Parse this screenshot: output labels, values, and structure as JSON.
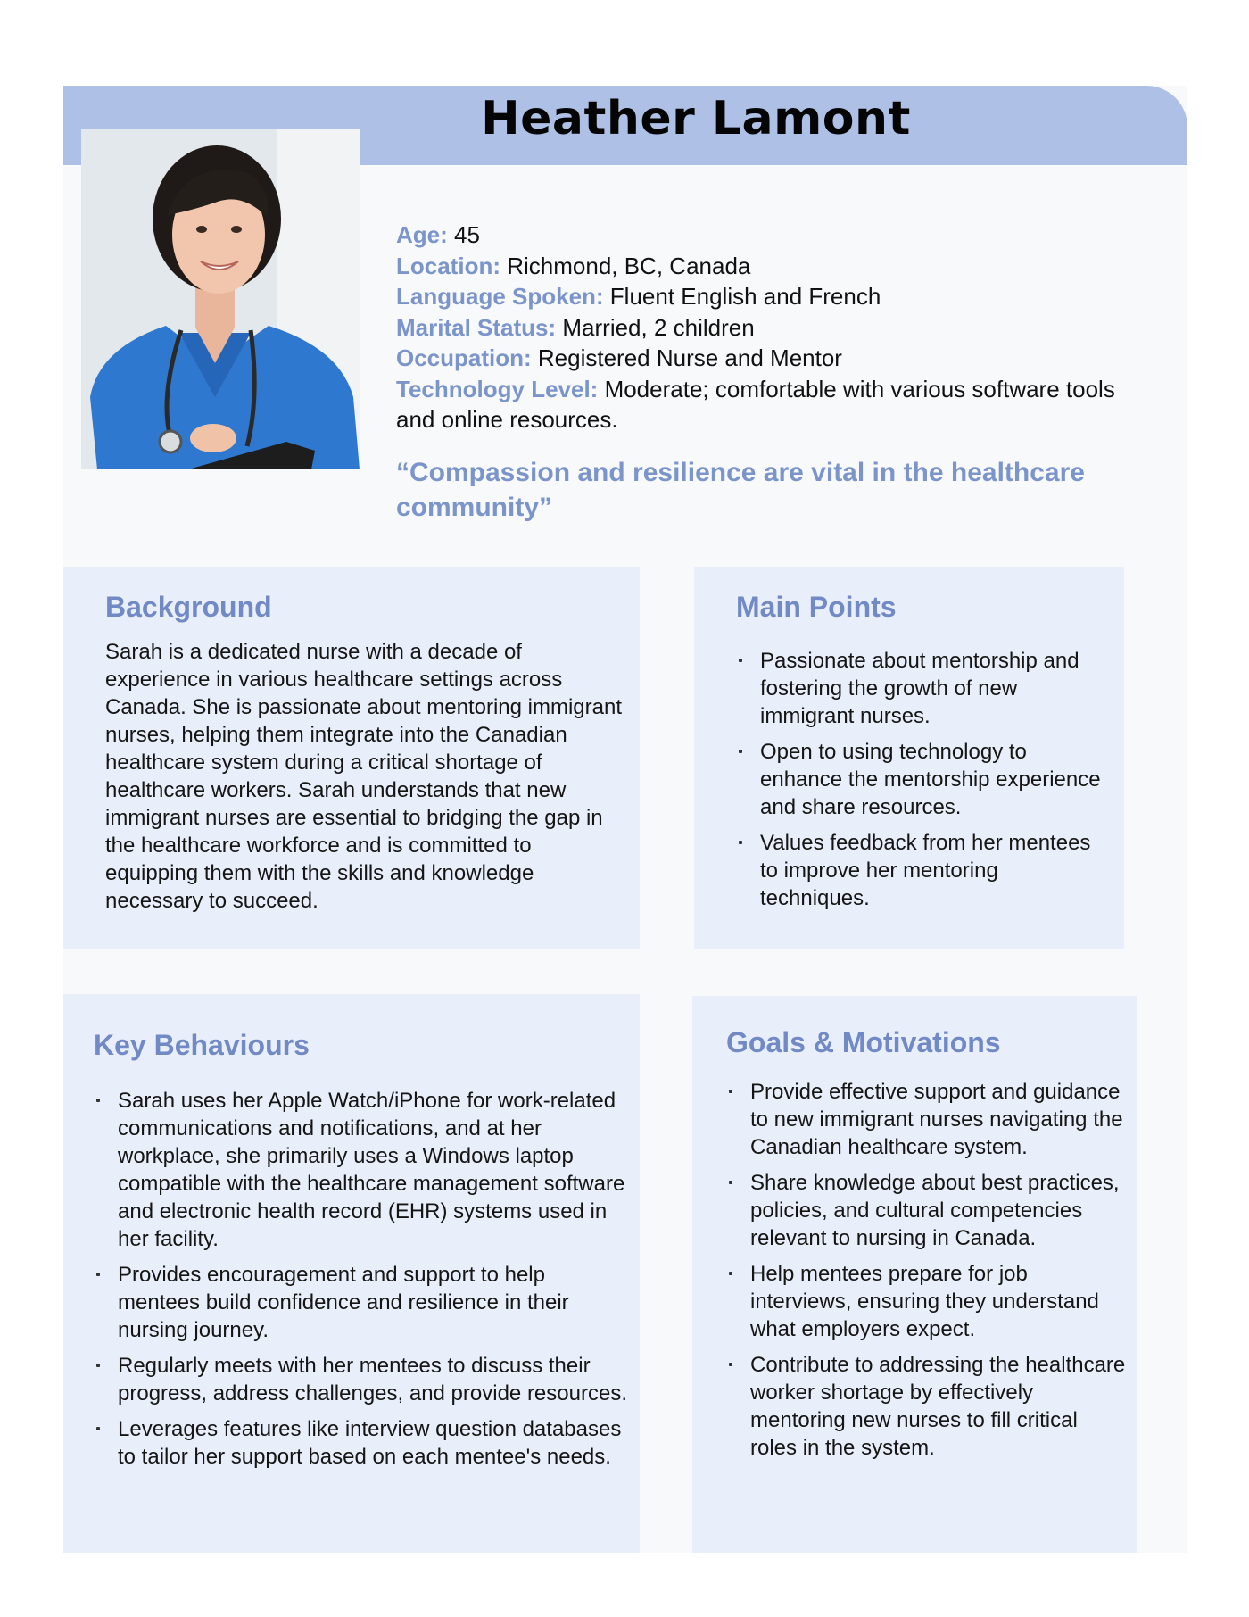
{
  "persona": {
    "name": "Heather Lamont",
    "photo_alt": "nurse-portrait",
    "details": [
      {
        "label": "Age:",
        "value": " 45"
      },
      {
        "label": "Location:",
        "value": " Richmond, BC, Canada"
      },
      {
        "label": "Language Spoken:",
        "value": " Fluent English and French"
      },
      {
        "label": "Marital Status:",
        "value": " Married, 2 children"
      },
      {
        "label": "Occupation:",
        "value": " Registered Nurse and Mentor"
      },
      {
        "label": "Technology Level:",
        "value": " Moderate; comfortable with various software tools and online resources."
      }
    ],
    "quote": "“Compassion and resilience are vital in the healthcare community”"
  },
  "background": {
    "title": "Background",
    "text": "Sarah is a dedicated nurse with a decade of experience in various healthcare settings across Canada. She is passionate about mentoring immigrant nurses, helping them integrate into the Canadian healthcare system during a critical shortage of healthcare workers. Sarah understands that new immigrant nurses are essential to bridging the gap in the healthcare workforce and is committed to equipping them with the skills and knowledge necessary to succeed."
  },
  "main_points": {
    "title": "Main Points",
    "items": [
      "Passionate about mentorship and fostering the growth of new immigrant nurses.",
      "Open to using technology to enhance the mentorship experience and share resources.",
      "Values feedback from her mentees to improve her mentoring techniques."
    ]
  },
  "key_behaviours": {
    "title": "Key Behaviours",
    "items": [
      "Sarah uses her Apple Watch/iPhone for work-related communications and notifications, and at her workplace, she primarily uses a Windows laptop compatible with the healthcare management software and electronic health record (EHR) systems used in her facility.",
      "Provides encouragement and support to help mentees build confidence and resilience in their nursing journey.",
      "Regularly meets with her mentees to discuss their progress, address challenges, and provide resources.",
      "Leverages features like interview question databases to tailor her support based on each mentee's needs."
    ]
  },
  "goals": {
    "title": "Goals & Motivations",
    "items": [
      "Provide effective support and guidance to new immigrant nurses navigating the Canadian healthcare system.",
      "Share knowledge about best practices, policies, and cultural competencies relevant to nursing in Canada.",
      "Help mentees prepare for job interviews, ensuring they understand what employers expect.",
      "Contribute to addressing the healthcare worker shortage by effectively mentoring new nurses to fill critical roles in the system."
    ]
  },
  "colors": {
    "header_band": "#aec0e6",
    "accent_text": "#7b95cb",
    "panel_bg": "#e9effa",
    "page_bg": "#f8f9fa"
  }
}
